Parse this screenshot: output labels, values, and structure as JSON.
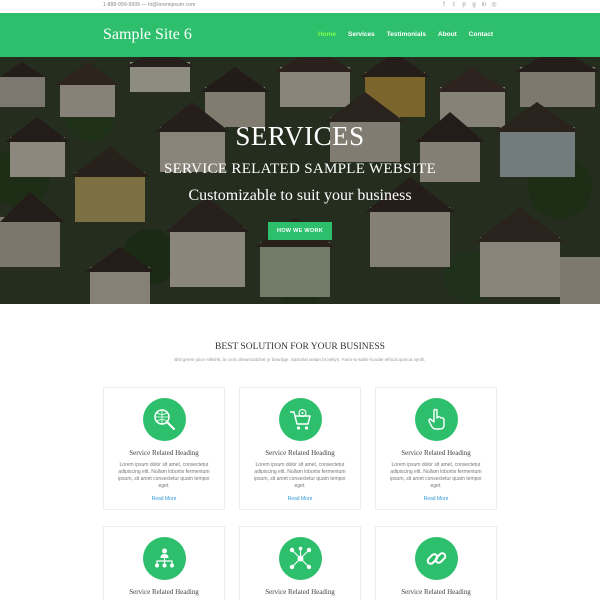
{
  "topbar": {
    "contact": "1-888-999-9999 — hi@loremipsum.com",
    "social_icons": [
      "facebook-icon",
      "twitter-icon",
      "pinterest-icon",
      "google-plus-icon",
      "linkedin-icon",
      "instagram-icon"
    ]
  },
  "nav": {
    "brand": "Sample Site 6",
    "items": [
      {
        "label": "Home",
        "active": true
      },
      {
        "label": "Services",
        "active": false
      },
      {
        "label": "Testimonials",
        "active": false
      },
      {
        "label": "About",
        "active": false
      },
      {
        "label": "Contact",
        "active": false
      }
    ]
  },
  "hero": {
    "title": "SERVICES",
    "subtitle": "SERVICE RELATED SAMPLE WEBSITE",
    "tagline": "Customizable to suit your business",
    "button": "HOW WE WORK"
  },
  "section": {
    "title": "BEST SOLUTION FOR YOUR BUSINESS",
    "subtitle": "Bitil green juice mlkshk, la croix dreamcatcher yr beardge. Sartorial seitan brooklyn, Farm-to-table hoodie ethical quinoa synth."
  },
  "cards": [
    {
      "icon": "magnifier-globe-icon",
      "heading": "Service Related Heading",
      "body": "Lorem ipsum dolor sit amet, consectetur adipiscing elit. Nullam lobortis fermentum ipsum, sit amet consectetur quam tempor eget.",
      "link": "Read More"
    },
    {
      "icon": "shopping-cart-icon",
      "heading": "Service Related Heading",
      "body": "Lorem ipsum dolor sit amet, consectetur adipiscing elit. Nullam lobortis fermentum ipsum, sit amet consectetur quam tempor eget.",
      "link": "Read More"
    },
    {
      "icon": "pointing-hand-icon",
      "heading": "Service Related Heading",
      "body": "Lorem ipsum dolor sit amet, consectetur adipiscing elit. Nullam lobortis fermentum ipsum, sit amet consectetur quam tempor eget.",
      "link": "Read More"
    },
    {
      "icon": "org-chart-icon",
      "heading": "Service Related Heading"
    },
    {
      "icon": "network-icon",
      "heading": "Service Related Heading"
    },
    {
      "icon": "link-icon",
      "heading": "Service Related Heading"
    }
  ],
  "colors": {
    "accent": "#2ebf6d",
    "nav_active": "#7cff4a",
    "link": "#2e9bd6"
  }
}
